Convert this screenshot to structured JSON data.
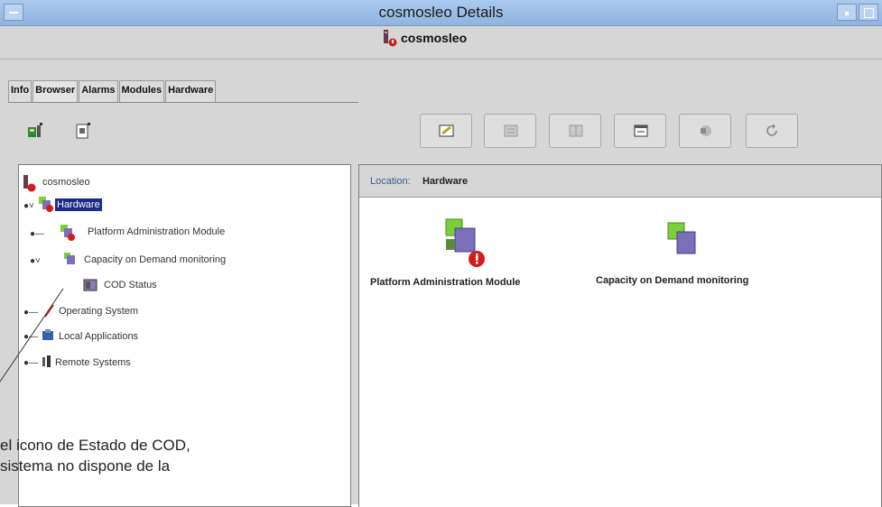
{
  "window": {
    "title": "cosmosleo Details",
    "host": "cosmosleo"
  },
  "tabs": [
    {
      "label": "Info"
    },
    {
      "label": "Browser"
    },
    {
      "label": "Alarms"
    },
    {
      "label": "Modules"
    },
    {
      "label": "Hardware"
    }
  ],
  "tree": {
    "root": "cosmosleo",
    "hardware": "Hardware",
    "pam": "Platform Administration Module",
    "cod": "Capacity on Demand monitoring",
    "cod_status": "COD Status",
    "os": "Operating System",
    "local_apps": "Local Applications",
    "remote": "Remote Systems"
  },
  "location": {
    "label": "Location:",
    "value": "Hardware"
  },
  "content": {
    "obj1": "Platform Administration Module",
    "obj2": "Capacity on Demand monitoring"
  },
  "callout": {
    "line1": "el icono de Estado de COD,",
    "line2": "sistema no dispone de la"
  },
  "colors": {
    "selection": "#1c2a8a",
    "titlebar": "#a9c9ee",
    "alarm": "#d61a1a"
  }
}
